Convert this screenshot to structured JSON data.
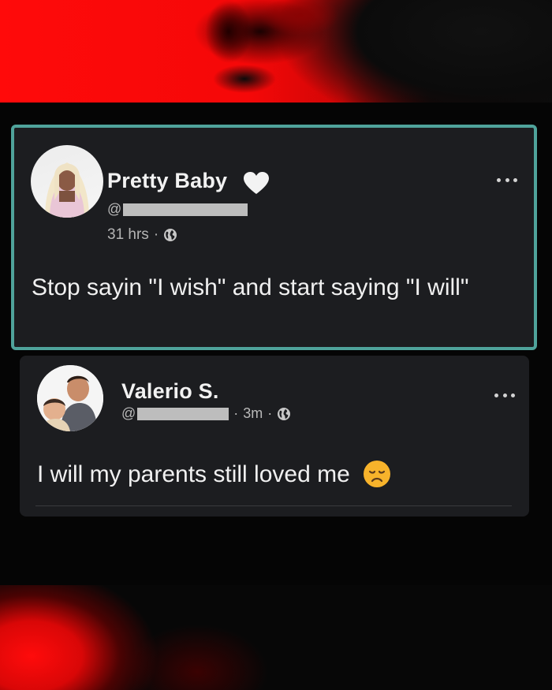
{
  "post": {
    "author": "Pretty Baby",
    "handle_prefix": "@",
    "time": "31 hrs",
    "separator": "·",
    "text": "Stop sayin \"I wish\" and start saying \"I will\"",
    "heart_icon": "white-heart-icon",
    "privacy_icon": "globe-icon"
  },
  "reply": {
    "author": "Valerio S.",
    "handle_prefix": "@",
    "separator": "·",
    "time": "3m",
    "text": "I will my parents still loved me",
    "emoji_icon": "disappointed-face-emoji",
    "privacy_icon": "globe-icon"
  },
  "colors": {
    "highlight_border": "#4fa39b",
    "card_bg": "#1c1d20",
    "accent_red": "#ff0a0a"
  }
}
